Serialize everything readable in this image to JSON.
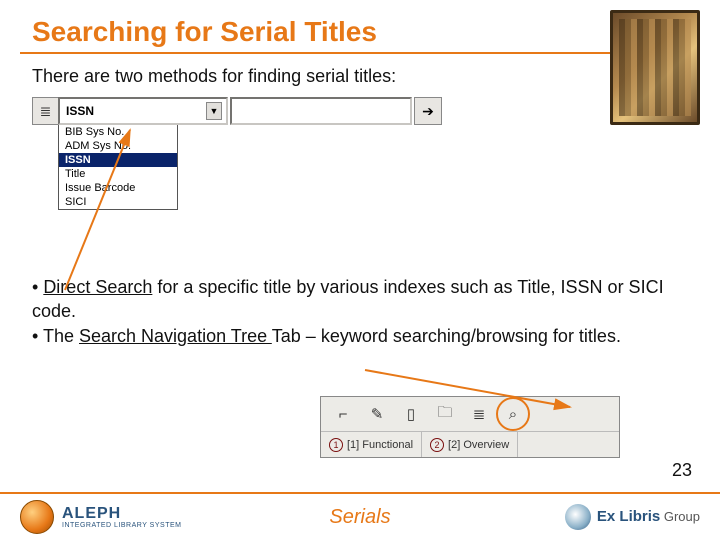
{
  "title": "Searching for Serial Titles",
  "intro": "There are two methods for finding serial titles:",
  "search": {
    "selected": "ISSN",
    "input_value": "",
    "options": [
      "BIB Sys No.",
      "ADM Sys No.",
      "ISSN",
      "Title",
      "Issue Barcode",
      "SICI"
    ],
    "selected_index": 2
  },
  "bullets": {
    "b1_prefix": "• ",
    "b1_link": "Direct Search",
    "b1_rest": " for a specific title by various indexes such as Title, ISSN or SICI code.",
    "b2_prefix": "• The ",
    "b2_link": "Search Navigation Tree ",
    "b2_rest": "Tab – keyword searching/browsing for titles."
  },
  "tabbar": {
    "tabs": [
      {
        "idx": "1",
        "label": "[1] Functional"
      },
      {
        "idx": "2",
        "label": "[2] Overview"
      }
    ]
  },
  "page_number": "23",
  "footer": {
    "brand": "ALEPH",
    "brand_sub": "INTEGRATED LIBRARY SYSTEM",
    "center": "Serials",
    "right_b": "Ex Libris",
    "right_g": " Group"
  }
}
